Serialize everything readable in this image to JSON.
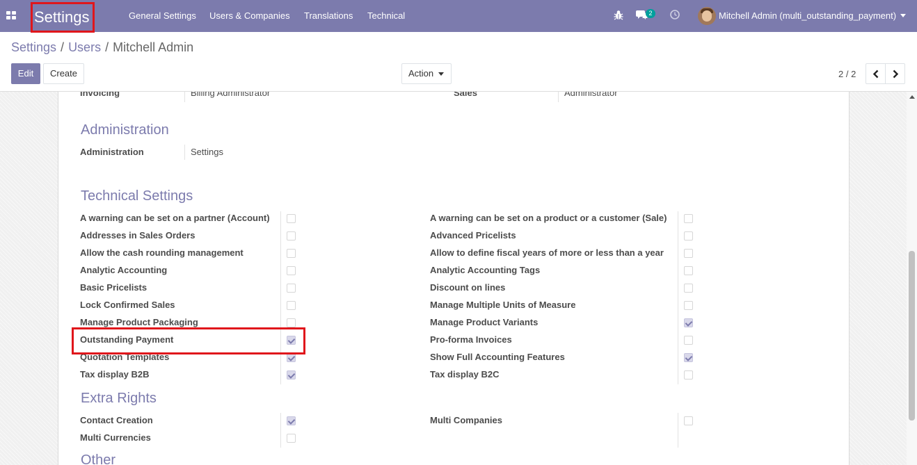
{
  "navbar": {
    "app_name": "Settings",
    "menu": [
      "General Settings",
      "Users & Companies",
      "Translations",
      "Technical"
    ],
    "chat_badge": "2",
    "user_label": "Mitchell Admin (multi_outstanding_payment)"
  },
  "breadcrumb": {
    "root": "Settings",
    "parent": "Users",
    "current": "Mitchell Admin"
  },
  "buttons": {
    "edit": "Edit",
    "create": "Create",
    "action": "Action"
  },
  "pager": {
    "value": "2 / 2"
  },
  "form": {
    "top_left": {
      "label": "Invoicing",
      "value": "Billing Administrator"
    },
    "top_right": {
      "label": "Sales",
      "value": "Administrator"
    },
    "administration": {
      "title": "Administration",
      "label": "Administration",
      "value": "Settings"
    },
    "technical_settings": {
      "title": "Technical Settings",
      "left": [
        {
          "label": "A warning can be set on a partner (Account)",
          "checked": false
        },
        {
          "label": "Addresses in Sales Orders",
          "checked": false
        },
        {
          "label": "Allow the cash rounding management",
          "checked": false
        },
        {
          "label": "Analytic Accounting",
          "checked": false
        },
        {
          "label": "Basic Pricelists",
          "checked": false
        },
        {
          "label": "Lock Confirmed Sales",
          "checked": false
        },
        {
          "label": "Manage Product Packaging",
          "checked": false
        },
        {
          "label": "Outstanding Payment",
          "checked": true
        },
        {
          "label": "Quotation Templates",
          "checked": true
        },
        {
          "label": "Tax display B2B",
          "checked": true
        }
      ],
      "right": [
        {
          "label": "A warning can be set on a product or a customer (Sale)",
          "checked": false
        },
        {
          "label": "Advanced Pricelists",
          "checked": false
        },
        {
          "label": "Allow to define fiscal years of more or less than a year",
          "checked": false
        },
        {
          "label": "Analytic Accounting Tags",
          "checked": false
        },
        {
          "label": "Discount on lines",
          "checked": false
        },
        {
          "label": "Manage Multiple Units of Measure",
          "checked": false
        },
        {
          "label": "Manage Product Variants",
          "checked": true
        },
        {
          "label": "Pro-forma Invoices",
          "checked": false
        },
        {
          "label": "Show Full Accounting Features",
          "checked": true
        },
        {
          "label": "Tax display B2C",
          "checked": false
        }
      ]
    },
    "extra_rights": {
      "title": "Extra Rights",
      "left": [
        {
          "label": "Contact Creation",
          "checked": true
        },
        {
          "label": "Multi Currencies",
          "checked": false
        }
      ],
      "right": [
        {
          "label": "Multi Companies",
          "checked": false
        }
      ]
    },
    "other": {
      "title": "Other"
    }
  },
  "colors": {
    "brand": "#7c7bad",
    "highlight": "#e0161b",
    "badge": "#00a09d"
  }
}
